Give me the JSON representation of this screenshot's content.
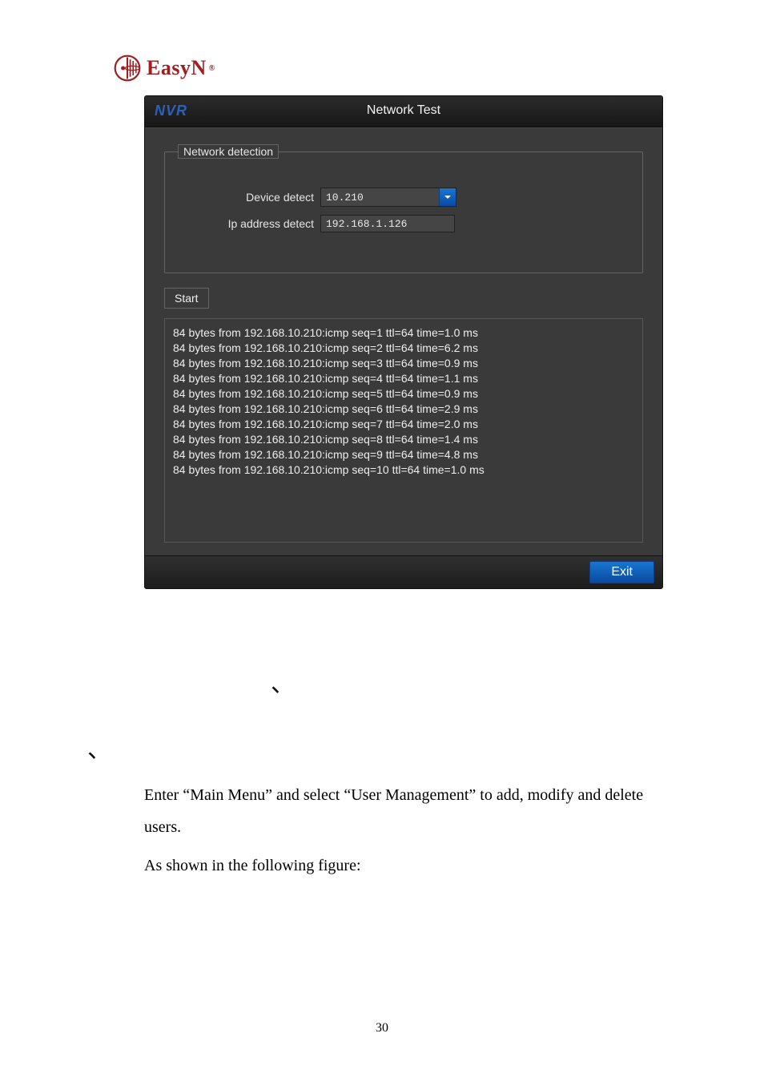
{
  "logo": {
    "text": "EasyN",
    "registered": "®"
  },
  "dialog": {
    "brand": "NVR",
    "title": "Network Test",
    "fieldset_legend": "Network detection",
    "device_detect_label": "Device detect",
    "device_detect_value": "10.210",
    "ip_detect_label": "Ip address detect",
    "ip_detect_value": "192.168.1.126",
    "start_label": "Start",
    "exit_label": "Exit",
    "output_lines": [
      "84 bytes from 192.168.10.210:icmp seq=1 ttl=64 time=1.0 ms",
      "84 bytes from 192.168.10.210:icmp seq=2 ttl=64 time=6.2 ms",
      "84 bytes from 192.168.10.210:icmp seq=3 ttl=64 time=0.9 ms",
      "84 bytes from 192.168.10.210:icmp seq=4 ttl=64 time=1.1 ms",
      "84 bytes from 192.168.10.210:icmp seq=5 ttl=64 time=0.9 ms",
      "84 bytes from 192.168.10.210:icmp seq=6 ttl=64 time=2.9 ms",
      "84 bytes from 192.168.10.210:icmp seq=7 ttl=64 time=2.0 ms",
      "84 bytes from 192.168.10.210:icmp seq=8 ttl=64 time=1.4 ms",
      "84 bytes from 192.168.10.210:icmp seq=9 ttl=64 time=4.8 ms",
      "84 bytes from 192.168.10.210:icmp seq=10 ttl=64 time=1.0 ms"
    ]
  },
  "stray": {
    "tick1": "、",
    "tick2": "、"
  },
  "doc": {
    "line1": "Enter “Main Menu” and select “User Management” to add, modify and delete users.",
    "line2": "As shown in the following figure:"
  },
  "page_number": "30"
}
